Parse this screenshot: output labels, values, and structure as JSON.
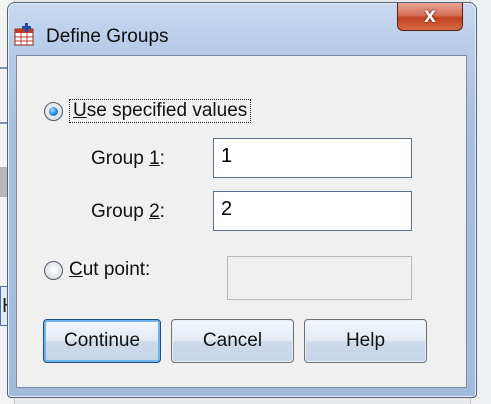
{
  "background": {
    "left_edge_letter": "H"
  },
  "dialog": {
    "title": "Define Groups",
    "close_glyph": "x",
    "options": {
      "use_specified_values": {
        "label_prefix": "",
        "mnemonic": "U",
        "label_rest": "se specified values",
        "selected": true
      },
      "cut_point": {
        "mnemonic": "C",
        "label_rest": "ut point:",
        "selected": false,
        "value": ""
      }
    },
    "group1": {
      "label_prefix": "Group ",
      "mnemonic": "1",
      "label_suffix": ":",
      "value": "1"
    },
    "group2": {
      "label_prefix": "Group ",
      "mnemonic": "2",
      "label_suffix": ":",
      "value": "2"
    },
    "buttons": {
      "continue": "Continue",
      "cancel": "Cancel",
      "help": "Help"
    }
  },
  "colors": {
    "title_bar": "#b9cde8",
    "close_button": "#c2431f",
    "default_button_glow": "#6fb5ec"
  }
}
